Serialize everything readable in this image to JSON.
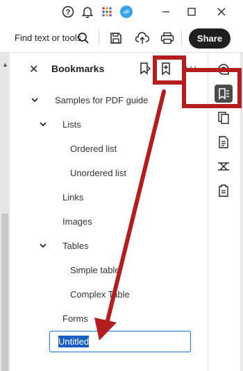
{
  "toolbar": {
    "find_label": "Find text or tools",
    "share_label": "Share"
  },
  "panel": {
    "title": "Bookmarks",
    "more_label": "···",
    "items": [
      {
        "label": "Samples for PDF guide",
        "level": 0,
        "expanded": true
      },
      {
        "label": "Lists",
        "level": 1,
        "expanded": true
      },
      {
        "label": "Ordered list",
        "level": 2
      },
      {
        "label": "Unordered list",
        "level": 2
      },
      {
        "label": "Links",
        "level": 1
      },
      {
        "label": "Images",
        "level": 1
      },
      {
        "label": "Tables",
        "level": 1,
        "expanded": true
      },
      {
        "label": "Simple table",
        "level": 2
      },
      {
        "label": "Complex Table",
        "level": 2
      },
      {
        "label": "Forms",
        "level": 1
      }
    ],
    "rename_value": "Untitled"
  },
  "icons": {
    "help": "help-icon",
    "bell": "bell-icon",
    "apps": "apps-grid-icon",
    "profile": "profile-icon",
    "search": "search-icon",
    "save": "save-icon",
    "upload": "cloud-upload-icon",
    "print": "print-icon"
  },
  "colors": {
    "annotation_red": "#b31d1d",
    "selection_blue": "#1a5fbf",
    "input_border": "#1473e6",
    "share_bg": "#1f1f1f",
    "rail_active": "#4b4b4b"
  }
}
